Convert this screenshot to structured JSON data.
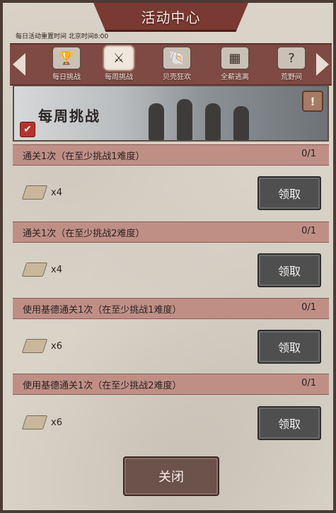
{
  "title": "活动中心",
  "reset_note": "每日活动重置时间 北京时间8:00",
  "tabs": [
    {
      "label": "每日挑战",
      "icon": "trophy-icon"
    },
    {
      "label": "每周挑战",
      "icon": "crossed-axes-icon"
    },
    {
      "label": "贝壳狂欢",
      "icon": "shell-icon"
    },
    {
      "label": "全薪逃离",
      "icon": "cage-icon"
    },
    {
      "label": "荒野间",
      "icon": "question-icon"
    }
  ],
  "active_tab": 1,
  "banner": {
    "title": "每周挑战",
    "info_symbol": "!",
    "check_symbol": "✔"
  },
  "tasks": [
    {
      "title": "通关1次（在至少挑战1难度）",
      "progress": "0/1",
      "reward_count": "x4",
      "button": "领取"
    },
    {
      "title": "通关1次（在至少挑战2难度）",
      "progress": "0/1",
      "reward_count": "x4",
      "button": "领取"
    },
    {
      "title": "使用基德通关1次（在至少挑战1难度）",
      "progress": "0/1",
      "reward_count": "x6",
      "button": "领取"
    },
    {
      "title": "使用基德通关1次（在至少挑战2难度）",
      "progress": "0/1",
      "reward_count": "x6",
      "button": "领取"
    }
  ],
  "close_label": "关闭",
  "colors": {
    "accent": "#7a3a33",
    "header": "#bf8f86",
    "button": "#4f4f4f"
  }
}
